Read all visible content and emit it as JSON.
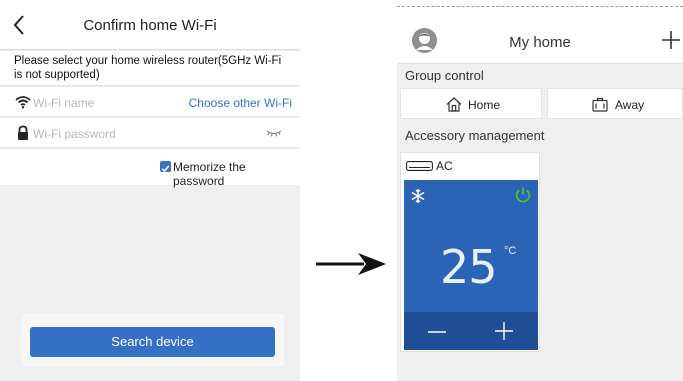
{
  "left_screen": {
    "title": "Confirm home Wi-Fi",
    "instruction": "Please select your home wireless router(5GHz Wi-Fi is not supported)",
    "wifi_name_placeholder": "Wi-Fi name",
    "choose_other_wifi": "Choose other Wi-Fi",
    "wifi_password_placeholder": "Wi-Fi password",
    "memorize_password": {
      "label": "Memorize the password",
      "checked": true
    },
    "search_button": "Search device"
  },
  "right_screen": {
    "title": "My home",
    "group_control_label": "Group control",
    "modes": [
      {
        "label": "Home",
        "icon": "house-icon"
      },
      {
        "label": "Away",
        "icon": "suitcase-icon"
      }
    ],
    "accessory_management_label": "Accessory management",
    "device": {
      "name": "AC",
      "temperature": "25",
      "unit": "°C",
      "mode_icon": "snowflake-icon",
      "power_on": true
    }
  },
  "colors": {
    "accent_blue": "#3471c6",
    "ac_panel": "#2b64b6",
    "power_green": "#49c52f"
  }
}
